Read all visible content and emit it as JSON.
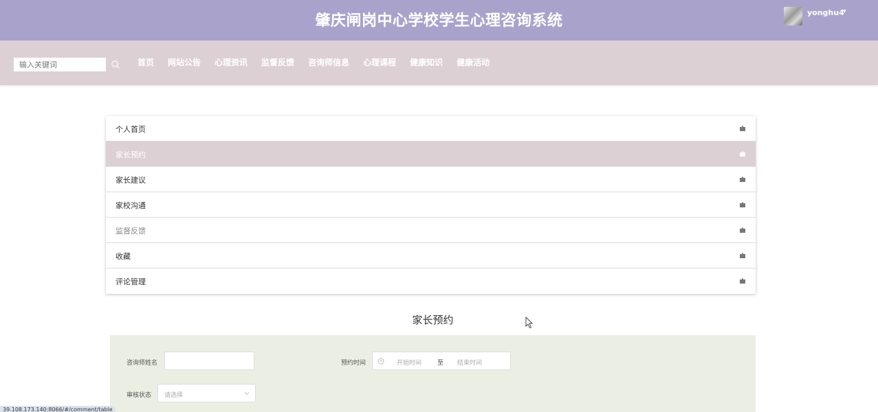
{
  "header": {
    "title": "肇庆闸岗中心学校学生心理咨询系统",
    "username": "yonghu4"
  },
  "nav": {
    "search_placeholder": "输入关键词",
    "items": [
      "首页",
      "网站公告",
      "心理资讯",
      "监督反馈",
      "咨询师信息",
      "心理课程",
      "健康知识",
      "健康活动"
    ]
  },
  "menu": {
    "items": [
      {
        "label": "个人首页",
        "active": false
      },
      {
        "label": "家长预约",
        "active": true
      },
      {
        "label": "家长建议",
        "active": false
      },
      {
        "label": "家校沟通",
        "active": false
      },
      {
        "label": "监督反馈",
        "active": false
      },
      {
        "label": "收藏",
        "active": false
      },
      {
        "label": "评论管理",
        "active": false
      }
    ]
  },
  "section": {
    "title": "家长预约"
  },
  "filters": {
    "counselor_label": "咨询师姓名",
    "time_label": "预约时间",
    "start_placeholder": "开始时间",
    "separator": "至",
    "end_placeholder": "结束时间",
    "status_label": "审核状态",
    "status_placeholder": "请选择"
  },
  "status_bar": {
    "url": "39.108.173.140:8066/#/comment/table"
  },
  "colors": {
    "header_bg": "#a9a3cc",
    "nav_bg": "#ddd0d4",
    "active_row_bg": "#ddd0d4",
    "filter_bg": "#ebefe3"
  }
}
